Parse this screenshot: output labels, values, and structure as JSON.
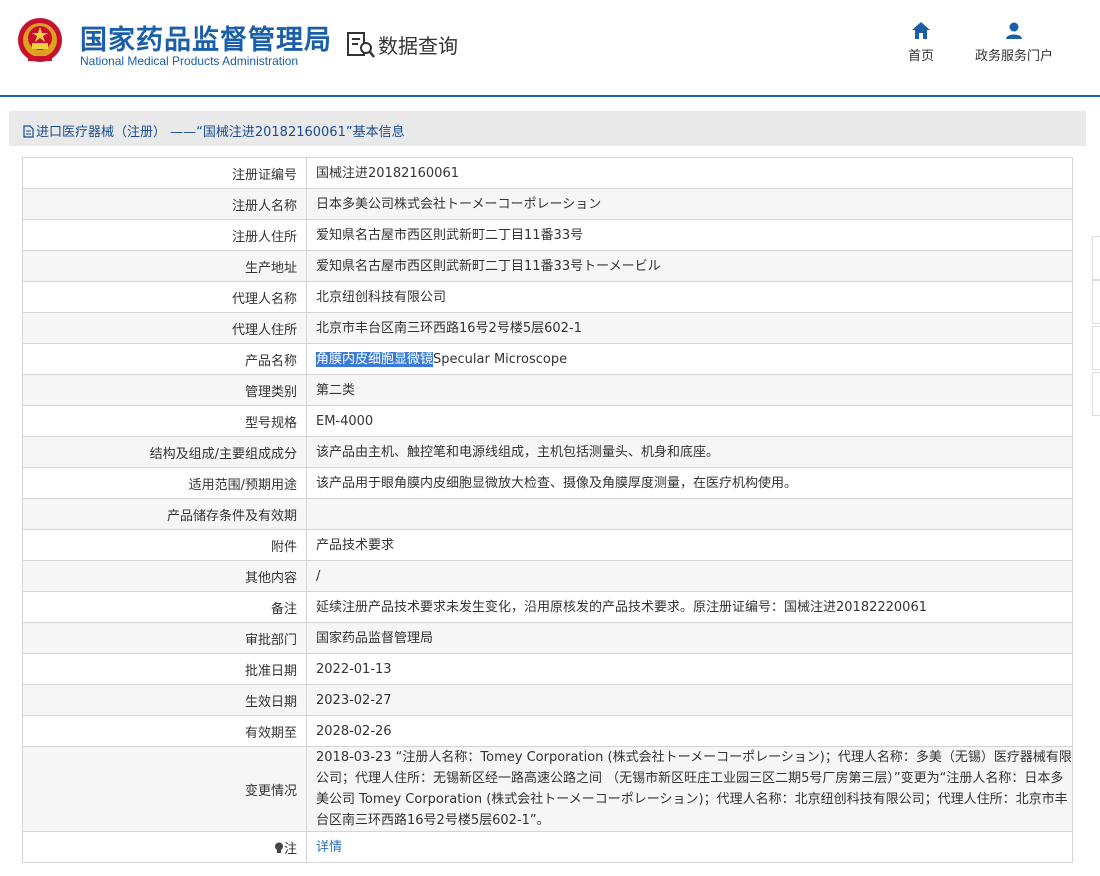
{
  "header": {
    "logo_cn": "国家药品监督管理局",
    "logo_en": "National Medical Products Administration",
    "section_title": "数据查询",
    "nav": [
      {
        "label": "首页",
        "icon": "home-icon"
      },
      {
        "label": "政务服务门户",
        "icon": "user-icon"
      }
    ]
  },
  "breadcrumb": {
    "text": "进口医疗器械（注册） ——“国械注进20182160061”基本信息"
  },
  "colors": {
    "brand": "#1a5fa8",
    "highlight": "#3a7bd5",
    "link": "#2a6dbf"
  },
  "rows": [
    {
      "label": "注册证编号",
      "value": "国械注进20182160061"
    },
    {
      "label": "注册人名称",
      "value": "日本多美公司株式会社トーメーコーポレーション"
    },
    {
      "label": "注册人住所",
      "value": "爱知県名古屋市西区則武新町二丁目11番33号"
    },
    {
      "label": "生产地址",
      "value": "爱知県名古屋市西区則武新町二丁目11番33号トーメービル"
    },
    {
      "label": "代理人名称",
      "value": "北京纽创科技有限公司"
    },
    {
      "label": "代理人住所",
      "value": "北京市丰台区南三环西路16号2号楼5层602-1"
    },
    {
      "label": "产品名称",
      "value_highlight": "角膜内皮细胞显微镜",
      "value_rest": "Specular Microscope"
    },
    {
      "label": "管理类别",
      "value": "第二类"
    },
    {
      "label": "型号规格",
      "value": "EM-4000"
    },
    {
      "label": "结构及组成/主要组成成分",
      "value": "该产品由主机、触控笔和电源线组成，主机包括测量头、机身和底座。"
    },
    {
      "label": "适用范围/预期用途",
      "value": "该产品用于眼角膜内皮细胞显微放大检查、摄像及角膜厚度测量，在医疗机构使用。"
    },
    {
      "label": "产品储存条件及有效期",
      "value": ""
    },
    {
      "label": "附件",
      "value": "产品技术要求"
    },
    {
      "label": "其他内容",
      "value": "/"
    },
    {
      "label": "备注",
      "value": "延续注册产品技术要求未发生变化，沿用原核发的产品技术要求。原注册证编号：国械注进20182220061"
    },
    {
      "label": "审批部门",
      "value": "国家药品监督管理局"
    },
    {
      "label": "批准日期",
      "value": "2022-01-13"
    },
    {
      "label": "生效日期",
      "value": "2023-02-27"
    },
    {
      "label": "有效期至",
      "value": "2028-02-26"
    },
    {
      "label": "变更情况",
      "value": "2018-03-23 “注册人名称：Tomey Corporation (株式会社トーメーコーポレーション)；代理人名称：多美（无锡）医疗器械有限公司；代理人住所：无锡新区经一路高速公路之间 （无锡市新区旺庄工业园三区二期5号厂房第三层）”变更为“注册人名称：日本多美公司 Tomey Corporation (株式会社トーメーコーポレーション)；代理人名称：北京纽创科技有限公司；代理人住所：北京市丰台区南三环西路16号2号楼5层602-1”。"
    },
    {
      "label": "注",
      "value": "详情",
      "icon": "bulb-icon"
    }
  ]
}
